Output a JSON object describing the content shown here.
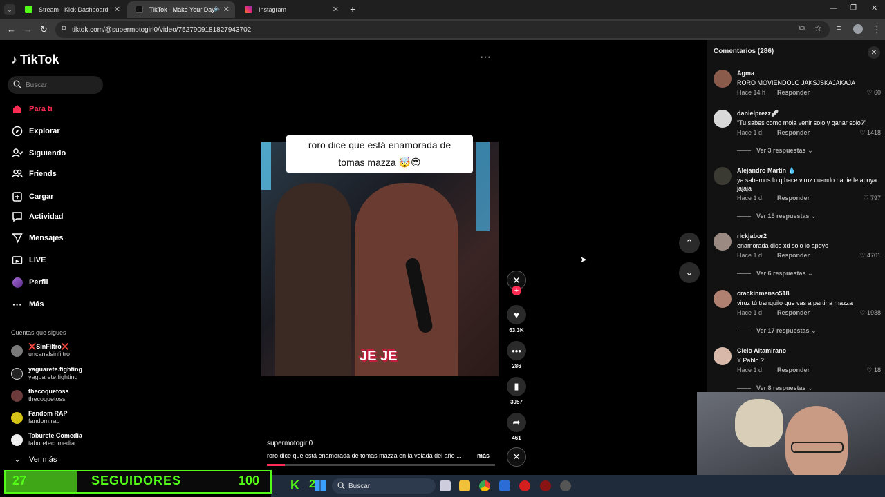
{
  "browser": {
    "tabs": [
      {
        "title": "Stream - Kick Dashboard",
        "favicon_color": "#53fc18"
      },
      {
        "title": "TikTok - Make Your Day",
        "favicon_color": "#000000"
      },
      {
        "title": "Instagram",
        "favicon_color": "#e1306c"
      }
    ],
    "new_tab": "+",
    "url": "tiktok.com/@supermotogirl0/video/7527909181827943702"
  },
  "sidebar": {
    "logo_text": "TikTok",
    "search_placeholder": "Buscar",
    "nav": [
      {
        "label": "Para ti",
        "icon": "home-icon",
        "active": true
      },
      {
        "label": "Explorar",
        "icon": "compass-icon"
      },
      {
        "label": "Siguiendo",
        "icon": "user-check-icon"
      },
      {
        "label": "Friends",
        "icon": "users-icon"
      },
      {
        "label": "Cargar",
        "icon": "plus-square-icon"
      },
      {
        "label": "Actividad",
        "icon": "message-square-icon"
      },
      {
        "label": "Mensajes",
        "icon": "send-icon"
      },
      {
        "label": "LIVE",
        "icon": "live-icon"
      },
      {
        "label": "Perfil",
        "icon": "avatar-icon"
      },
      {
        "label": "Más",
        "icon": "more-icon"
      }
    ],
    "following_title": "Cuentas que sigues",
    "following": [
      {
        "name": "❌SinFiltro❌",
        "handle": "uncanalsinfiltro"
      },
      {
        "name": "yaguarete.fighting",
        "handle": "yaguarete.fighting"
      },
      {
        "name": "thecoquetoss",
        "handle": "thecoquetoss"
      },
      {
        "name": "Fandom RAP",
        "handle": "fandom.rap"
      },
      {
        "name": "Taburete Comedia",
        "handle": "taburetecomedia"
      }
    ],
    "see_more": "Ver más"
  },
  "video": {
    "caption_line1": "roro dice que está enamorada de",
    "caption_line2": "tomas mazza 🤯😍",
    "overlay_text": "JE JE",
    "author": "supermotogirl0",
    "description": "roro dice que está enamorada de tomas mazza en la velada del año ...",
    "more": "más",
    "progress": 0.08,
    "actions": {
      "likes": "63.3K",
      "comments": "286",
      "saves": "3057",
      "shares": "461"
    }
  },
  "comments_panel": {
    "title": "Comentarios (286)",
    "reply_label": "Responder",
    "items": [
      {
        "user": "Agma",
        "text": "RORO MOVIENDOLO JAKSJSKAJAKAJA",
        "time": "Hace 14 h",
        "likes": "60",
        "more": ""
      },
      {
        "user": "danielprezz🩹",
        "text": "“Tu sabes como mola venir solo y ganar solo?”",
        "time": "Hace 1 d",
        "likes": "1418",
        "more": "Ver 3 respuestas"
      },
      {
        "user": "Alejandro Martín 💧",
        "text": "ya sabemos lo q hace viruz cuando nadie le apoya jajaja",
        "time": "Hace 1 d",
        "likes": "797",
        "more": "Ver 15 respuestas"
      },
      {
        "user": "rickjabor2",
        "text": "enamorada dice xd solo lo apoyo",
        "time": "Hace 1 d",
        "likes": "4701",
        "more": "Ver 6 respuestas"
      },
      {
        "user": "crackinmenso518",
        "text": "viruz tú tranquilo que vas a partir a mazza",
        "time": "Hace 1 d",
        "likes": "1938",
        "more": "Ver 17 respuestas"
      },
      {
        "user": "Cielo Altamirano",
        "text": "Y Pablo ?",
        "time": "Hace 1 d",
        "likes": "18",
        "more": "Ver 8 respuestas"
      }
    ]
  },
  "follower_goal": {
    "current": "27",
    "label": "SEGUIDORES",
    "goal": "100",
    "fraction": 0.27
  },
  "taskbar": {
    "search_placeholder": "Buscar",
    "kick_count": "2"
  },
  "colors": {
    "tiktok_accent": "#fe2c55",
    "kick_green": "#53fc18"
  }
}
